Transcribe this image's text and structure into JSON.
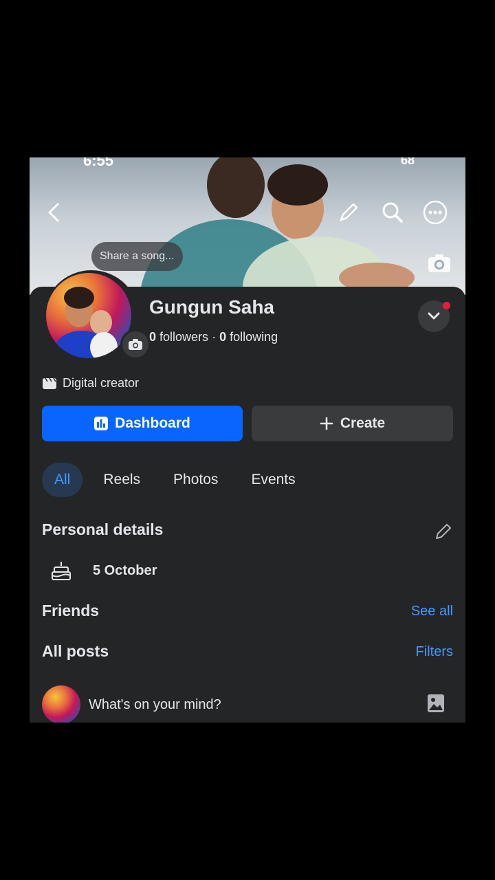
{
  "status_bar": {
    "time": "6:55",
    "battery": "68"
  },
  "cover": {
    "share_song_label": "Share a song...",
    "icons": [
      "back-arrow-icon",
      "pencil-icon",
      "search-icon",
      "more-icon",
      "camera-icon"
    ]
  },
  "profile": {
    "name": "Gungun Saha",
    "followers_count": "0",
    "followers_label": "followers",
    "separator": "·",
    "following_count": "0",
    "following_label": "following",
    "category": "Digital creator"
  },
  "actions": {
    "dashboard_label": "Dashboard",
    "create_label": "Create"
  },
  "tabs": [
    {
      "label": "All",
      "active": true
    },
    {
      "label": "Reels",
      "active": false
    },
    {
      "label": "Photos",
      "active": false
    },
    {
      "label": "Events",
      "active": false
    }
  ],
  "personal_details": {
    "title": "Personal details",
    "birthday": "5 October"
  },
  "friends": {
    "title": "Friends",
    "see_all": "See all"
  },
  "posts": {
    "title": "All posts",
    "filters": "Filters",
    "composer_placeholder": "What's on your mind?"
  },
  "colors": {
    "accent": "#0866ff",
    "link": "#4599ff",
    "background": "#242526",
    "notification_dot": "#e41e3f"
  }
}
